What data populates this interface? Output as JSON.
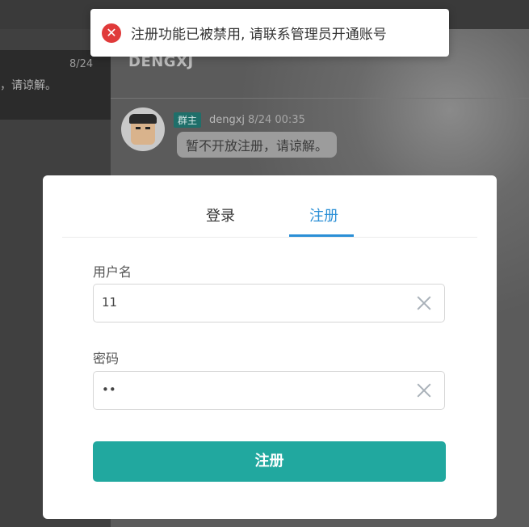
{
  "background": {
    "chat_date": "8/24",
    "chat_snippet": "，请谅解。",
    "room_name": "DENGXJ",
    "message": {
      "badge": "群主",
      "sender": "dengxj",
      "time": "8/24 00:35",
      "text": "暂不开放注册，请谅解。"
    }
  },
  "toast": {
    "icon": "error-icon",
    "icon_glyph": "✕",
    "text": "注册功能已被禁用, 请联系管理员开通账号",
    "color": "#e03a3a"
  },
  "modal": {
    "tabs": [
      {
        "label": "登录",
        "active": false
      },
      {
        "label": "注册",
        "active": true
      }
    ],
    "username": {
      "label": "用户名",
      "value": "11"
    },
    "password": {
      "label": "密码",
      "value": "••"
    },
    "submit_label": "注册",
    "accent": "#2a8fd6",
    "button_color": "#21a89f"
  }
}
